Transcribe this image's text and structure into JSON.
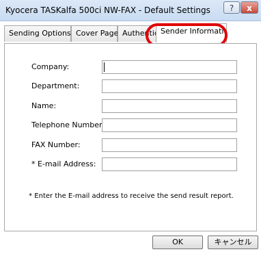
{
  "window": {
    "title": "Kyocera TASKalfa 500ci NW-FAX - Default Settings",
    "help_label": "?",
    "close_label": "x"
  },
  "tabs": [
    {
      "label": "Sending Options",
      "selected": false
    },
    {
      "label": "Cover Page",
      "selected": false
    },
    {
      "label": "Authenticiation",
      "selected": false
    },
    {
      "label": "Sender Information",
      "selected": true
    }
  ],
  "form": {
    "fields": [
      {
        "label": "Company:",
        "value": ""
      },
      {
        "label": "Department:",
        "value": ""
      },
      {
        "label": "Name:",
        "value": ""
      },
      {
        "label": "Telephone Number:",
        "value": ""
      },
      {
        "label": "FAX Number:",
        "value": ""
      },
      {
        "label": "* E-mail Address:",
        "value": ""
      }
    ],
    "note": "* Enter the E-mail address to receive the send result report."
  },
  "buttons": {
    "ok_label": "OK",
    "cancel_label": "キャンセル"
  },
  "colors": {
    "highlight": "#e00000",
    "titlebar": "#c9dcf2"
  }
}
